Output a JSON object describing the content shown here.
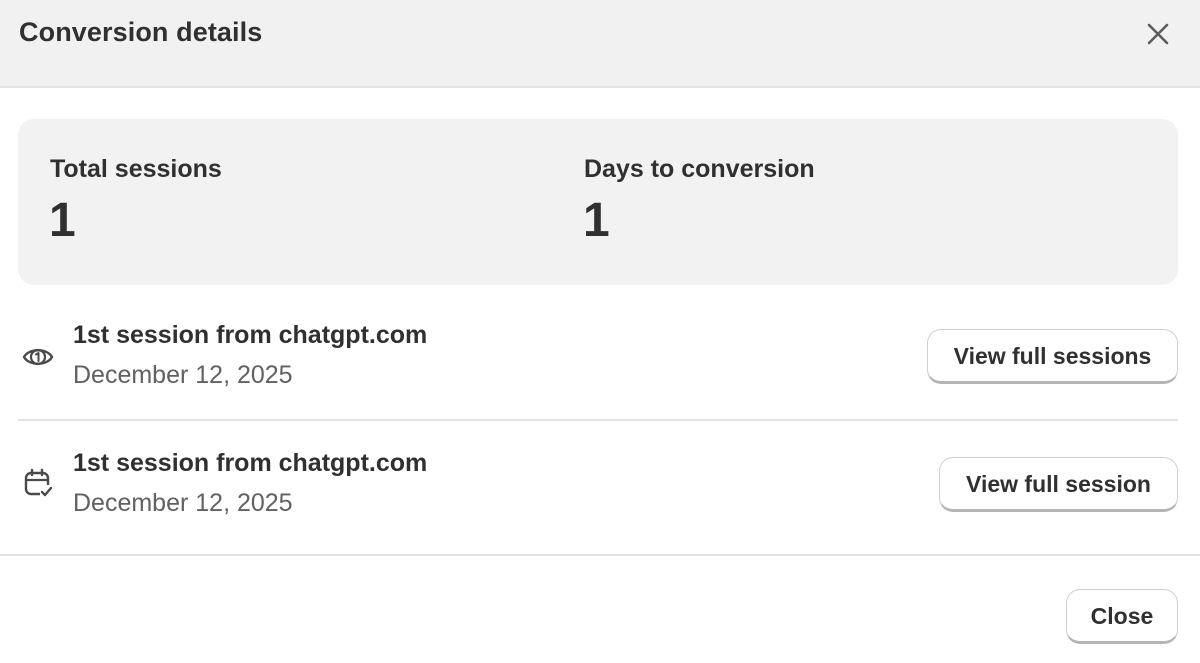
{
  "dialog": {
    "title": "Conversion details"
  },
  "summary": {
    "total_sessions_label": "Total sessions",
    "total_sessions_value": "1",
    "days_to_conversion_label": "Days to conversion",
    "days_to_conversion_value": "1"
  },
  "sessions": [
    {
      "icon": "numbered-eye-icon",
      "title": "1st session from chatgpt.com",
      "date": "December 12, 2025",
      "button_label": "View full sessions"
    },
    {
      "icon": "calendar-check-icon",
      "title": "1st session from chatgpt.com",
      "date": "December 12, 2025",
      "button_label": "View full session"
    }
  ],
  "footer": {
    "close_label": "Close"
  },
  "colors": {
    "header_bg": "#f1f1f1",
    "summary_bg": "#f2f2f2",
    "text_primary": "#303030",
    "text_secondary": "#616161",
    "divider": "#e3e3e3"
  }
}
